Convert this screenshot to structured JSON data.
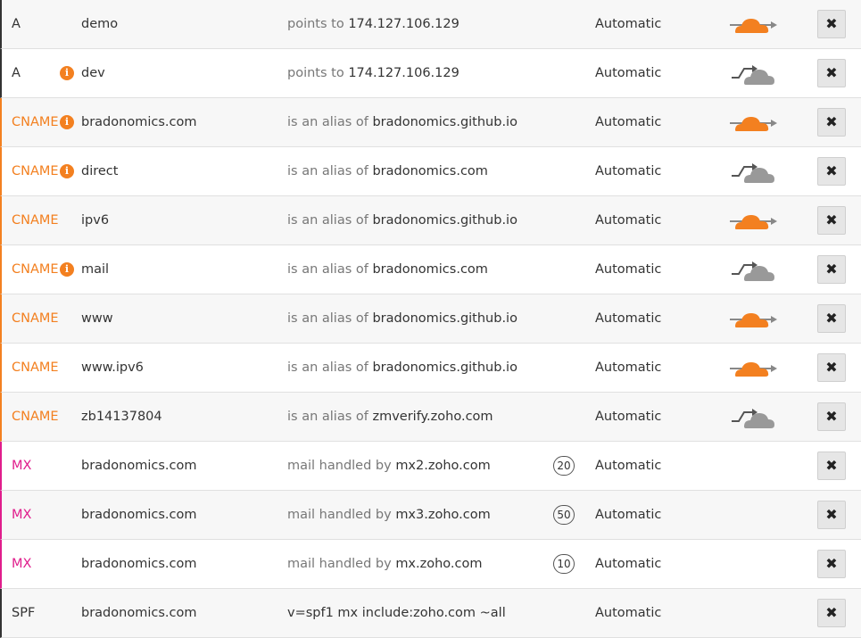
{
  "records": [
    {
      "type": "A",
      "info": false,
      "name": "demo",
      "value_prefix": "points to",
      "value": "174.127.106.129",
      "priority": "",
      "ttl": "Automatic",
      "proxy": "orange-cloud-icon"
    },
    {
      "type": "A",
      "info": true,
      "name": "dev",
      "value_prefix": "points to",
      "value": "174.127.106.129",
      "priority": "",
      "ttl": "Automatic",
      "proxy": "grey-cloud-icon"
    },
    {
      "type": "CNAME",
      "info": true,
      "name": "bradonomics.com",
      "value_prefix": "is an alias of",
      "value": "bradonomics.github.io",
      "priority": "",
      "ttl": "Automatic",
      "proxy": "orange-cloud-icon"
    },
    {
      "type": "CNAME",
      "info": true,
      "name": "direct",
      "value_prefix": "is an alias of",
      "value": "bradonomics.com",
      "priority": "",
      "ttl": "Automatic",
      "proxy": "grey-cloud-icon"
    },
    {
      "type": "CNAME",
      "info": false,
      "name": "ipv6",
      "value_prefix": "is an alias of",
      "value": "bradonomics.github.io",
      "priority": "",
      "ttl": "Automatic",
      "proxy": "orange-cloud-icon"
    },
    {
      "type": "CNAME",
      "info": true,
      "name": "mail",
      "value_prefix": "is an alias of",
      "value": "bradonomics.com",
      "priority": "",
      "ttl": "Automatic",
      "proxy": "grey-cloud-icon"
    },
    {
      "type": "CNAME",
      "info": false,
      "name": "www",
      "value_prefix": "is an alias of",
      "value": "bradonomics.github.io",
      "priority": "",
      "ttl": "Automatic",
      "proxy": "orange-cloud-icon"
    },
    {
      "type": "CNAME",
      "info": false,
      "name": "www.ipv6",
      "value_prefix": "is an alias of",
      "value": "bradonomics.github.io",
      "priority": "",
      "ttl": "Automatic",
      "proxy": "orange-cloud-icon"
    },
    {
      "type": "CNAME",
      "info": false,
      "name": "zb14137804",
      "value_prefix": "is an alias of",
      "value": "zmverify.zoho.com",
      "priority": "",
      "ttl": "Automatic",
      "proxy": "grey-cloud-icon"
    },
    {
      "type": "MX",
      "info": false,
      "name": "bradonomics.com",
      "value_prefix": "mail handled by",
      "value": "mx2.zoho.com",
      "priority": "20",
      "ttl": "Automatic",
      "proxy": ""
    },
    {
      "type": "MX",
      "info": false,
      "name": "bradonomics.com",
      "value_prefix": "mail handled by",
      "value": "mx3.zoho.com",
      "priority": "50",
      "ttl": "Automatic",
      "proxy": ""
    },
    {
      "type": "MX",
      "info": false,
      "name": "bradonomics.com",
      "value_prefix": "mail handled by",
      "value": "mx.zoho.com",
      "priority": "10",
      "ttl": "Automatic",
      "proxy": ""
    },
    {
      "type": "SPF",
      "info": false,
      "name": "bradonomics.com",
      "value_prefix": "",
      "value": "v=spf1 mx include:zoho.com ~all",
      "priority": "",
      "ttl": "Automatic",
      "proxy": ""
    }
  ],
  "icons": {
    "info": "info-icon",
    "delete": "close-icon",
    "delete_glyph": "✖",
    "info_glyph": "i"
  },
  "colors": {
    "cname": "#f38020",
    "mx": "#e01d8c",
    "a": "#333333",
    "orange_cloud": "#f38020",
    "grey_cloud": "#999999"
  }
}
